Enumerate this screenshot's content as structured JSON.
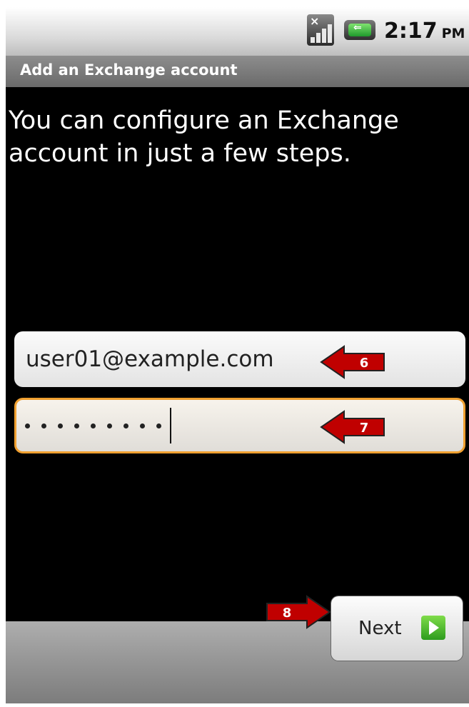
{
  "status_bar": {
    "time": "2:17",
    "ampm": "PM",
    "signal_icon": "no-signal-icon",
    "battery_icon": "charging-battery-icon"
  },
  "title_bar": {
    "title": "Add an Exchange account"
  },
  "intro_text": "You can configure an Exchange account in just a few steps.",
  "form": {
    "email_value": "user01@example.com",
    "password_mask_length": 9
  },
  "annotations": [
    {
      "label": "6",
      "target": "email field"
    },
    {
      "label": "7",
      "target": "password field"
    },
    {
      "label": "8",
      "target": "next button"
    }
  ],
  "footer": {
    "next_label": "Next"
  },
  "colors": {
    "focus_border": "#f0a030",
    "arrow_red": "#c00000",
    "next_icon_green": "#4cbb30"
  }
}
